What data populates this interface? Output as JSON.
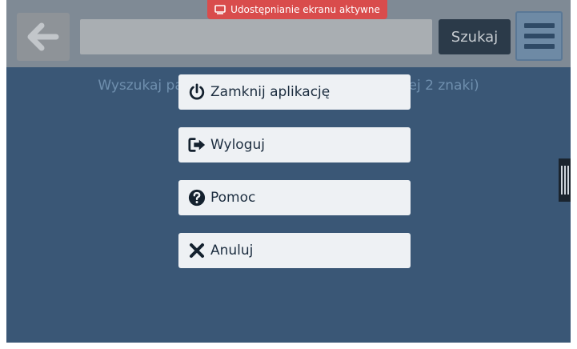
{
  "topbar": {
    "back_icon": "arrow-left-icon",
    "search_placeholder": "",
    "search_button": "Szukaj",
    "menu_icon": "hamburger-menu-icon"
  },
  "banner": {
    "icon": "screen-share-icon",
    "text": "Udostępnianie ekranu aktywne",
    "color": "#d94c4c"
  },
  "hint": {
    "text": "Wyszukaj pacjenta w bazie (wpisz przynajmniej 2 znaki)"
  },
  "menu": {
    "items": [
      {
        "icon": "power-icon",
        "label": "Zamknij aplikację"
      },
      {
        "icon": "sign-out-icon",
        "label": "Wyloguj"
      },
      {
        "icon": "question-circle-icon",
        "label": "Pomoc"
      },
      {
        "icon": "close-icon",
        "label": "Anuluj"
      }
    ]
  },
  "colors": {
    "background": "#3a5776",
    "menu_item_bg": "#eef1f4",
    "menu_text": "#1d2e40"
  }
}
